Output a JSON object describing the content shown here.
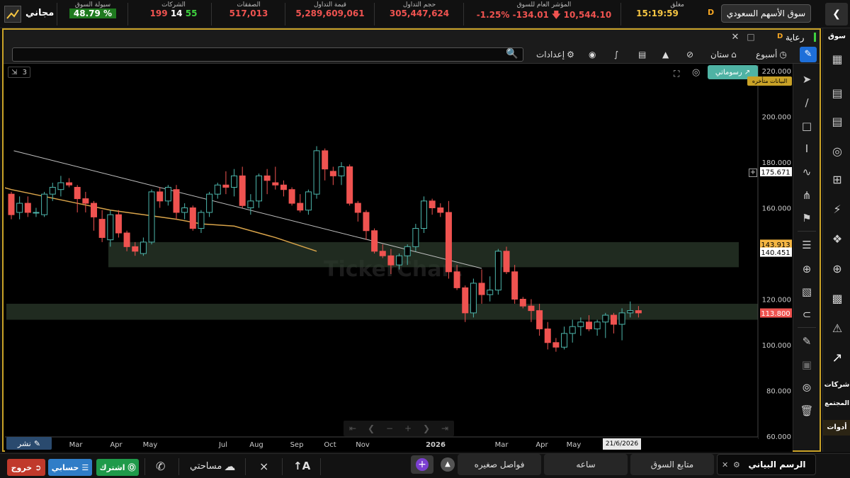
{
  "top": {
    "market_name": "سوق الأسهم السعودي",
    "market_code": "D",
    "status_label": "مغلق",
    "time": "15:19:59",
    "index_label": "المؤشر العام للسوق",
    "index_value": "10,544.10",
    "index_change": "-134.01",
    "index_change_pct": "-1.25%",
    "volume_label": "حجم التداول",
    "volume_value": "305,447,624",
    "turnover_label": "قيمة التداول",
    "turnover_value": "5,289,609,061",
    "trades_label": "الصفقات",
    "trades_value": "517,013",
    "companies_label": "الشركات",
    "companies_down": "199",
    "companies_flat": "14",
    "companies_up": "55",
    "liquidity_label": "سيولة السوق",
    "liquidity_value": "48.79 %",
    "free_label": "مجاني"
  },
  "window": {
    "title": "رعاية",
    "code": "D"
  },
  "toolbar": {
    "week_label": "أسبوع",
    "candles_label": "ستان",
    "settings_label": "إعدادات",
    "search_placeholder": ""
  },
  "chart": {
    "series_count": "3",
    "mode_label": "رسوماتي",
    "delayed_label": "البيانات متأخره",
    "watermark": "TickerChart",
    "share_label": "نشر",
    "date_badge": "21/6/2026"
  },
  "chart_data": {
    "type": "candlestick",
    "interval": "week",
    "ylim": [
      60,
      220
    ],
    "y_ticks": [
      "220.000",
      "200.000",
      "180.000",
      "160.000",
      "120.000",
      "100.000",
      "80.000",
      "60.000"
    ],
    "x_labels": [
      "Mar",
      "Apr",
      "May",
      "Jul",
      "Aug",
      "Sep",
      "Oct",
      "Nov",
      "2026",
      "Mar",
      "Apr",
      "May"
    ],
    "price_tags": [
      {
        "value": 175.671,
        "label": "175.671",
        "bg": "#ffffff",
        "fg": "#000000"
      },
      {
        "value": 143.913,
        "label": "143.913",
        "bg": "#f5b642",
        "fg": "#000000"
      },
      {
        "value": 140.451,
        "label": "140.451",
        "bg": "#ffffff",
        "fg": "#000000"
      },
      {
        "value": 113.8,
        "label": "113.800",
        "bg": "#ef5350",
        "fg": "#ffffff"
      }
    ],
    "zones": [
      {
        "low": 134,
        "high": 145
      },
      {
        "low": 111,
        "high": 118
      }
    ],
    "trendline": {
      "from": [
        0.3,
        185
      ],
      "to": [
        57,
        133.5
      ]
    },
    "ma": [
      [
        -25,
        193
      ],
      [
        0,
        168
      ],
      [
        8,
        162
      ],
      [
        12,
        159
      ],
      [
        16,
        157
      ],
      [
        20,
        155
      ],
      [
        23,
        153
      ],
      [
        27,
        152
      ],
      [
        32,
        147
      ],
      [
        37,
        141
      ]
    ],
    "candles": [
      [
        166,
        167,
        155,
        157
      ],
      [
        158,
        165,
        155,
        162
      ],
      [
        162,
        165,
        156,
        158
      ],
      [
        158,
        160,
        156,
        158
      ],
      [
        157,
        167,
        156,
        166
      ],
      [
        166,
        171,
        163,
        169
      ],
      [
        168,
        174,
        165,
        171
      ],
      [
        171,
        173,
        169,
        170
      ],
      [
        169,
        170,
        158,
        164
      ],
      [
        164,
        167,
        158,
        162
      ],
      [
        162,
        163,
        150,
        156
      ],
      [
        155,
        159,
        145,
        147
      ],
      [
        146,
        159,
        143,
        157
      ],
      [
        157,
        159,
        147,
        149
      ],
      [
        149,
        150,
        141,
        143
      ],
      [
        143,
        145,
        139,
        141
      ],
      [
        140,
        147,
        139,
        145
      ],
      [
        145,
        168,
        144,
        167
      ],
      [
        167,
        169,
        160,
        163
      ],
      [
        163,
        170,
        161,
        169
      ],
      [
        168,
        170,
        155,
        158
      ],
      [
        158,
        162,
        155,
        160
      ],
      [
        160,
        161,
        150,
        151
      ],
      [
        151,
        159,
        149,
        158
      ],
      [
        158,
        167,
        156,
        166
      ],
      [
        166,
        171,
        164,
        170
      ],
      [
        170,
        176,
        166,
        169
      ],
      [
        169,
        177,
        165,
        174
      ],
      [
        174,
        178,
        160,
        161
      ],
      [
        160,
        166,
        157,
        163
      ],
      [
        163,
        175,
        160,
        174
      ],
      [
        174,
        177,
        166,
        172
      ],
      [
        171,
        178,
        168,
        170
      ],
      [
        170,
        172,
        165,
        168
      ],
      [
        168,
        169,
        161,
        162
      ],
      [
        162,
        166,
        158,
        159
      ],
      [
        159,
        168,
        157,
        167
      ],
      [
        166,
        187,
        164,
        185
      ],
      [
        185,
        186,
        172,
        177
      ],
      [
        176,
        178,
        170,
        174
      ],
      [
        174,
        180,
        170,
        178
      ],
      [
        178,
        179,
        161,
        162
      ],
      [
        162,
        163,
        154,
        158
      ],
      [
        158,
        159,
        146,
        150
      ],
      [
        150,
        151,
        140,
        141
      ],
      [
        141,
        144,
        138,
        139
      ],
      [
        139,
        142,
        131,
        135
      ],
      [
        135,
        140,
        133,
        139
      ],
      [
        139,
        144,
        135,
        143
      ],
      [
        143,
        153,
        141,
        151
      ],
      [
        151,
        165,
        149,
        163
      ],
      [
        163,
        164,
        157,
        160
      ],
      [
        160,
        162,
        156,
        158
      ],
      [
        158,
        163,
        129,
        132
      ],
      [
        132,
        135,
        124,
        125
      ],
      [
        125,
        126,
        110,
        114
      ],
      [
        114,
        129,
        112,
        127
      ],
      [
        127,
        133,
        118,
        122
      ],
      [
        122,
        130,
        119,
        124
      ],
      [
        124,
        142,
        122,
        141
      ],
      [
        141,
        143,
        131,
        132
      ],
      [
        132,
        135,
        118,
        120
      ],
      [
        120,
        121,
        116,
        117
      ],
      [
        117,
        120,
        110,
        115
      ],
      [
        115,
        118,
        104,
        107
      ],
      [
        107,
        110,
        98,
        101
      ],
      [
        101,
        103,
        97,
        99
      ],
      [
        99,
        108,
        98,
        105
      ],
      [
        105,
        111,
        101,
        108
      ],
      [
        108,
        112,
        104,
        110
      ],
      [
        110,
        113,
        106,
        107
      ],
      [
        107,
        111,
        104,
        110
      ],
      [
        110,
        114,
        103,
        113
      ],
      [
        113,
        114,
        105,
        109
      ],
      [
        109,
        116,
        102,
        114
      ],
      [
        114,
        119,
        112,
        115
      ],
      [
        115,
        117,
        112,
        114
      ]
    ]
  },
  "rtools": {
    "tab_market": "سوق"
  },
  "sidebar": {
    "market_label": "سوق",
    "companies_label": "شركات",
    "community_label": "المجتمع",
    "tools_label": "أدوات"
  },
  "bottom": {
    "logout_label": "خروج",
    "account_label": "حسابي",
    "subscribe_label": "اشترك",
    "my_space_label": "مساحتي",
    "tab_small_gaps": "فواصل صغيره",
    "tab_clock": "ساعه",
    "tab_market_tracker": "متابع السوق",
    "tab_chart": "الرسم البياني"
  },
  "colors": {
    "accent": "#c9a227",
    "up": "#4db6ac",
    "down": "#ef5350",
    "bg": "#000000"
  }
}
